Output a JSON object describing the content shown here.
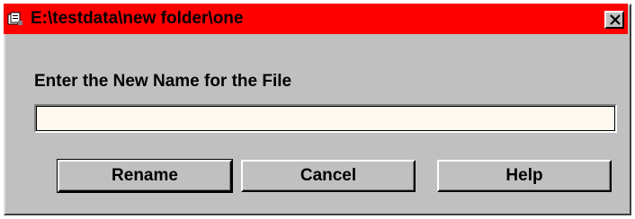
{
  "window": {
    "title": "E:\\testdata\\new folder\\one",
    "close_label": "Close",
    "title_bar_color": "#ff0000",
    "icon": "folder-document-icon"
  },
  "form": {
    "prompt": "Enter the New Name for the File",
    "name_value": "",
    "name_placeholder": ""
  },
  "buttons": {
    "rename": "Rename",
    "cancel": "Cancel",
    "help": "Help"
  }
}
